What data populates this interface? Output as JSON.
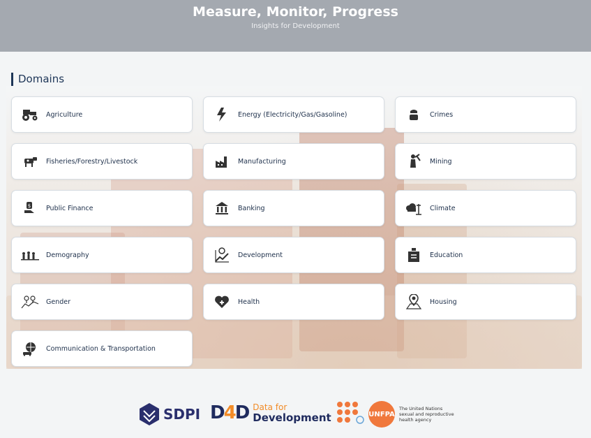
{
  "header": {
    "title": "Measure, Monitor, Progress",
    "subtitle": "Insights for Development"
  },
  "section": {
    "title": "Domains"
  },
  "domains": [
    {
      "label": "Agriculture",
      "icon": "tractor-icon"
    },
    {
      "label": "Energy (Electricity/Gas/Gasoline)",
      "icon": "energy-icon"
    },
    {
      "label": "Crimes",
      "icon": "police-icon"
    },
    {
      "label": "Fisheries/Forestry/Livestock",
      "icon": "cow-icon"
    },
    {
      "label": "Manufacturing",
      "icon": "factory-icon"
    },
    {
      "label": "Mining",
      "icon": "miner-icon"
    },
    {
      "label": "Public Finance",
      "icon": "money-hand-icon"
    },
    {
      "label": "Banking",
      "icon": "bank-icon"
    },
    {
      "label": "Climate",
      "icon": "climate-icon"
    },
    {
      "label": "Demography",
      "icon": "population-icon"
    },
    {
      "label": "Development",
      "icon": "growth-icon"
    },
    {
      "label": "Education",
      "icon": "school-icon"
    },
    {
      "label": "Gender",
      "icon": "gender-icon"
    },
    {
      "label": "Health",
      "icon": "health-heart-icon"
    },
    {
      "label": "Housing",
      "icon": "housing-pin-icon"
    },
    {
      "label": "Communication & Transportation",
      "icon": "transport-icon"
    }
  ],
  "footer": {
    "sdpi": "SDPI",
    "d4d_mark_a": "D",
    "d4d_mark_b": "4",
    "d4d_mark_c": "D",
    "d4d_line1": "Data for",
    "d4d_line2": "Development",
    "unfpa": "UNFPA",
    "unfpa_tagline": "The United Nations sexual and reproductive health agency"
  }
}
